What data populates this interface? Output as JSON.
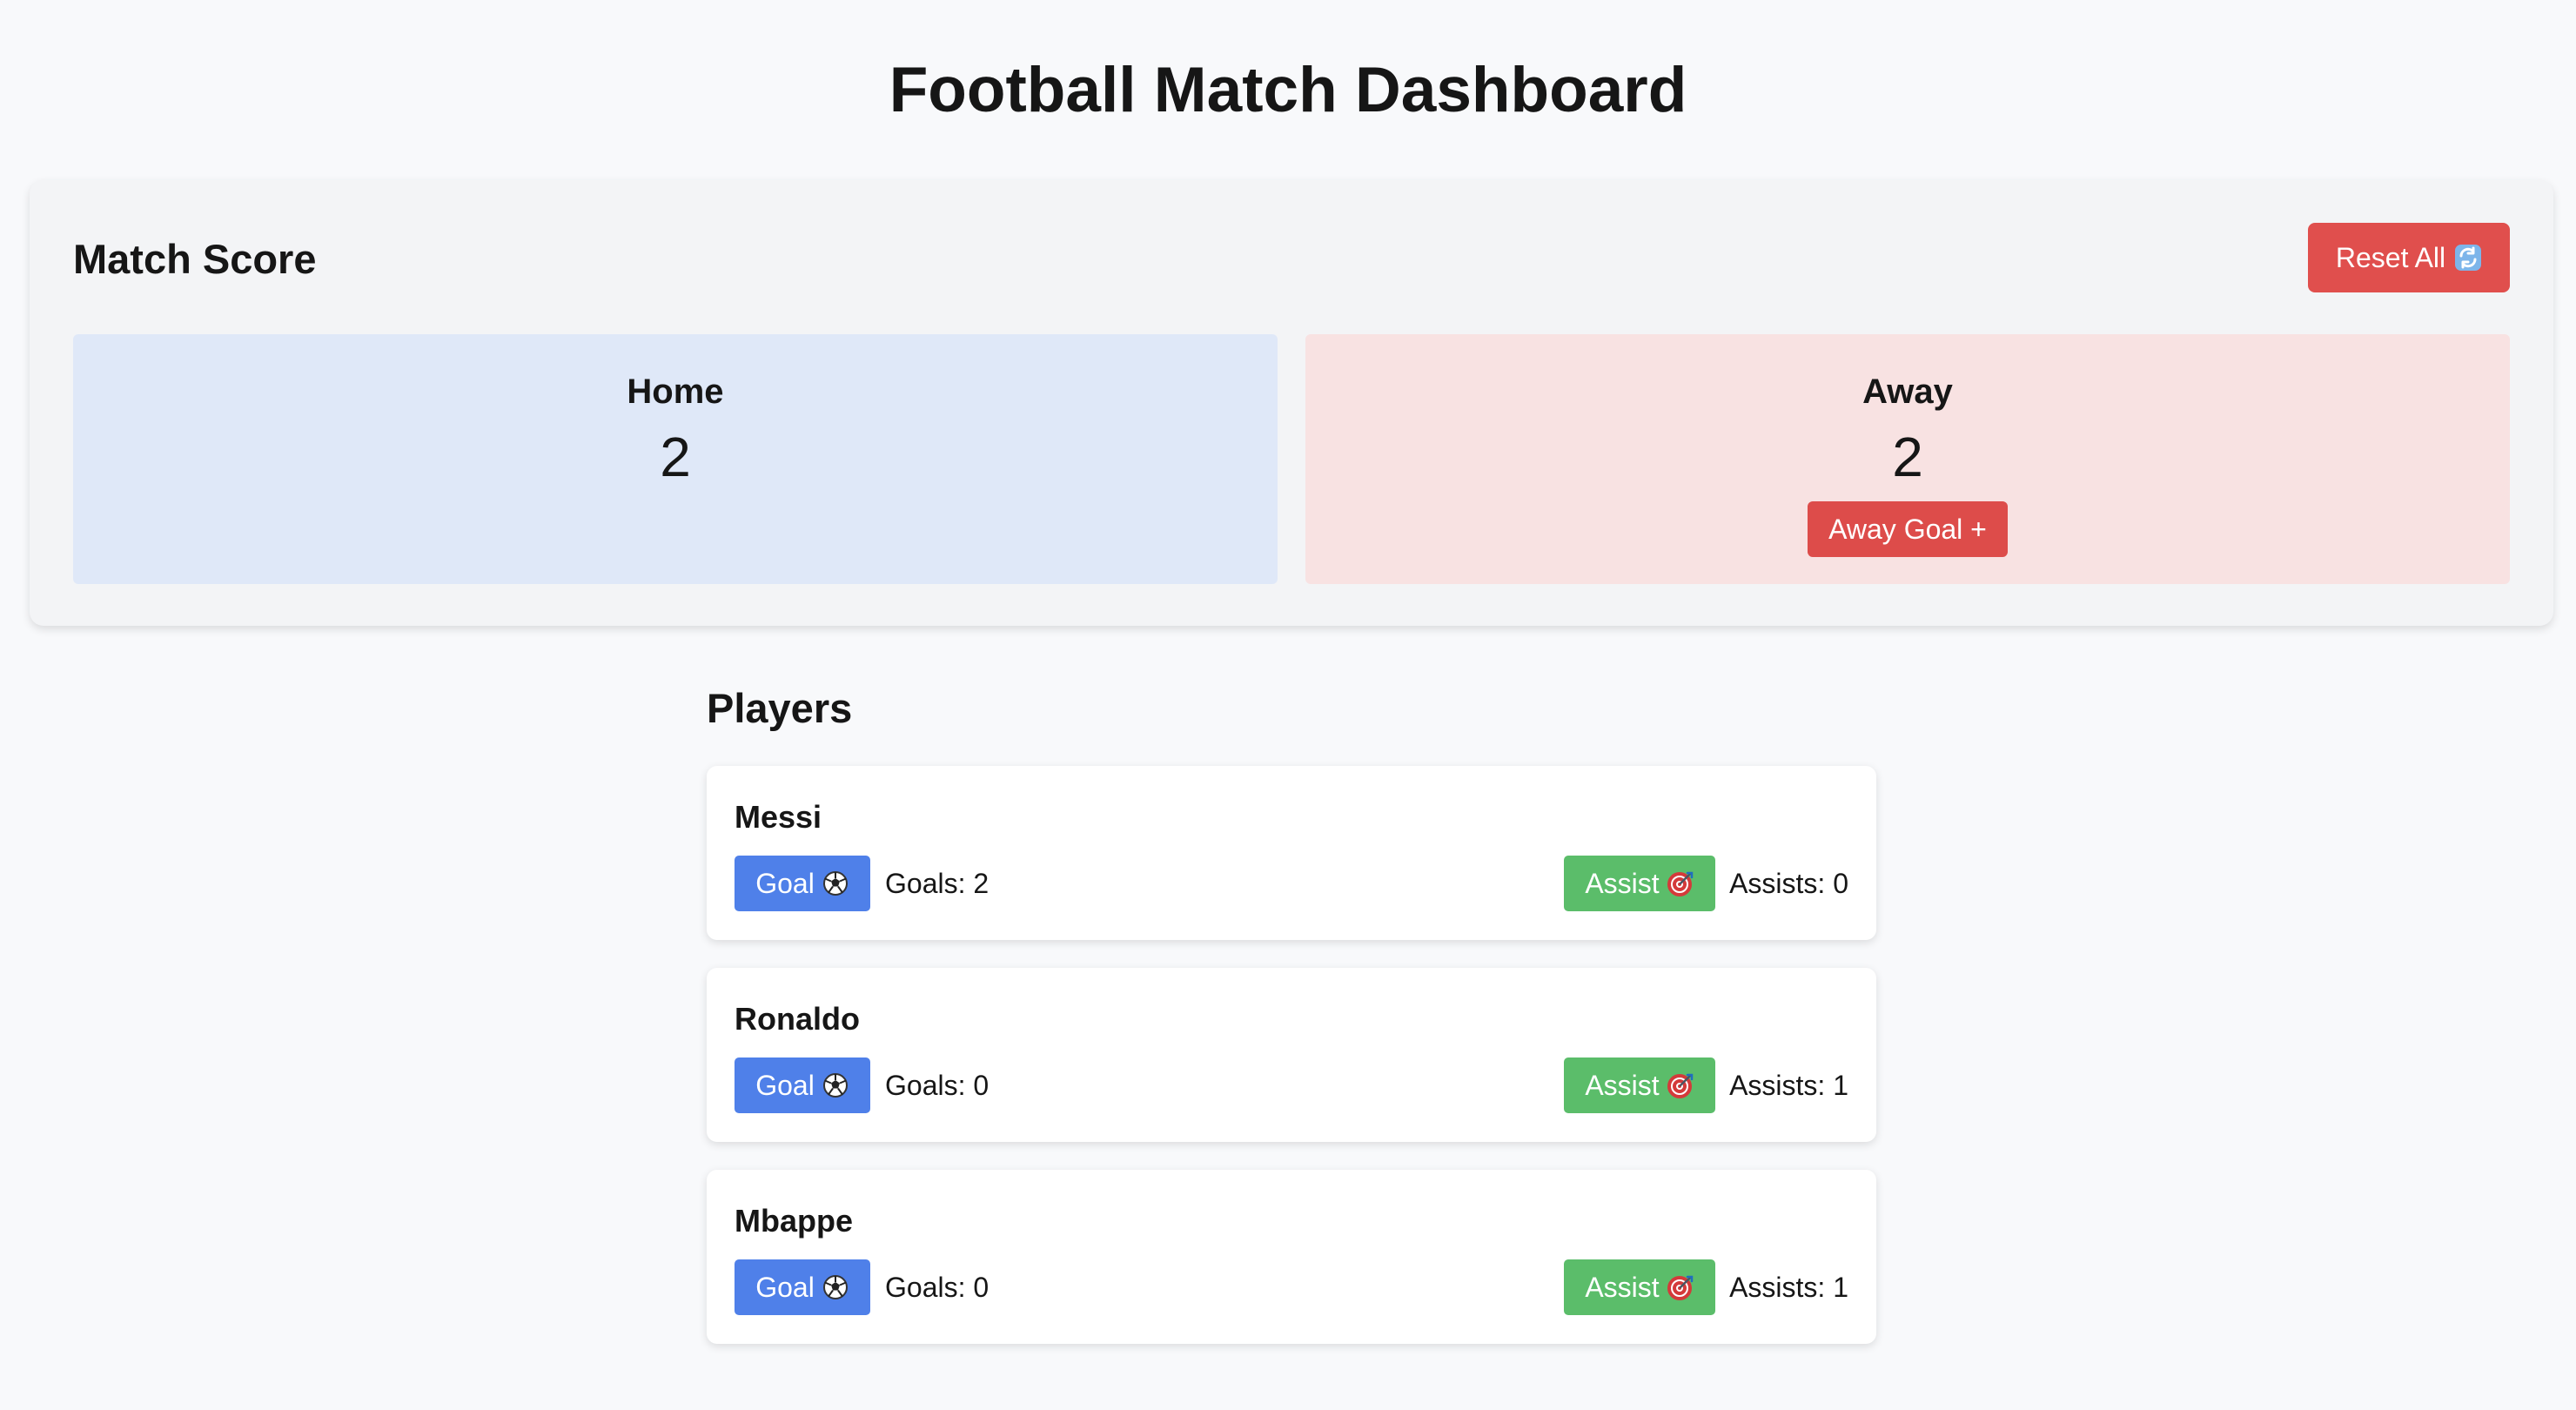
{
  "page": {
    "title": "Football Match Dashboard"
  },
  "score_panel": {
    "heading": "Match Score",
    "reset_label": "Reset All",
    "reset_icon": "refresh-icon",
    "home": {
      "name": "Home",
      "score": "2"
    },
    "away": {
      "name": "Away",
      "score": "2",
      "goal_button_label": "Away Goal +"
    }
  },
  "players": {
    "heading": "Players",
    "items": [
      {
        "name": "Messi",
        "goal_label": "Goal",
        "goal_icon": "soccer-ball-icon",
        "goals_text": "Goals: 2",
        "assist_label": "Assist",
        "assist_icon": "target-icon",
        "assists_text": "Assists: 0"
      },
      {
        "name": "Ronaldo",
        "goal_label": "Goal",
        "goal_icon": "soccer-ball-icon",
        "goals_text": "Goals: 0",
        "assist_label": "Assist",
        "assist_icon": "target-icon",
        "assists_text": "Assists: 1"
      },
      {
        "name": "Mbappe",
        "goal_label": "Goal",
        "goal_icon": "soccer-ball-icon",
        "goals_text": "Goals: 0",
        "assist_label": "Assist",
        "assist_icon": "target-icon",
        "assists_text": "Assists: 1"
      }
    ]
  },
  "colors": {
    "page_background": "#f8f9fb",
    "panel_background": "#f3f4f6",
    "home_background": "#dfe8f8",
    "away_background": "#f8e2e2",
    "reset_button": "#e04f4d",
    "away_goal_button": "#dd4c4a",
    "goal_button": "#4f80e9",
    "assist_button": "#5bbd6a"
  }
}
